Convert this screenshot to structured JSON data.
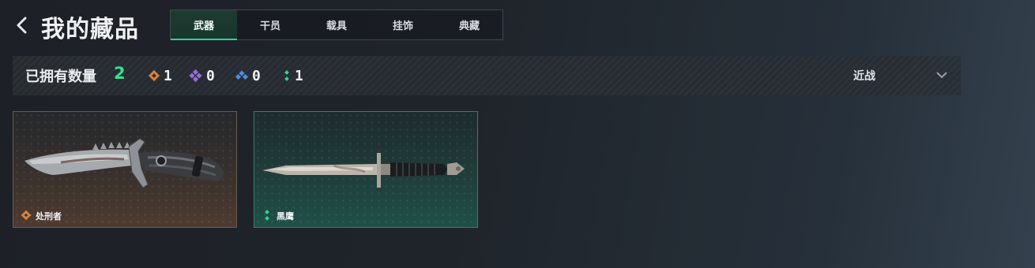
{
  "header": {
    "title": "我的藏品"
  },
  "tabs": [
    {
      "label": "武器",
      "active": true
    },
    {
      "label": "干员",
      "active": false
    },
    {
      "label": "载具",
      "active": false
    },
    {
      "label": "挂饰",
      "active": false
    },
    {
      "label": "典藏",
      "active": false
    }
  ],
  "summary": {
    "owned_label": "已拥有数量",
    "owned_count": "2",
    "stats": [
      {
        "icon": "orange-diamond-icon",
        "color": "#d9803e",
        "count": "1"
      },
      {
        "icon": "purple-diamond-icon",
        "color": "#9b6be0",
        "count": "0"
      },
      {
        "icon": "blue-triangle-icon",
        "color": "#4d8fe0",
        "count": "0"
      },
      {
        "icon": "green-dots-icon",
        "color": "#2fd68f",
        "count": "1"
      }
    ],
    "filter_value": "近战"
  },
  "items": [
    {
      "name": "处刑者",
      "rarity_color": "#d9803e",
      "rarity_icon": "orange-diamond-icon",
      "image": "combat-knife"
    },
    {
      "name": "黑鹰",
      "rarity_color": "#2fd68f",
      "rarity_icon": "green-dots-icon",
      "image": "bayonet-knife"
    }
  ],
  "colors": {
    "accent": "#2fd68f",
    "background": "#1f242a"
  }
}
